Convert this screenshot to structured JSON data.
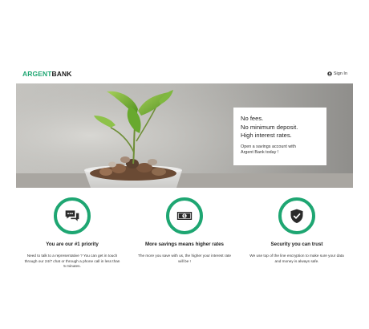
{
  "brand": {
    "accent_text": "ARGENT",
    "rest_text": "BANK",
    "accent_color": "#1ea672"
  },
  "header": {
    "signin_icon": "user-circle-icon",
    "signin_label": "Sign In"
  },
  "hero": {
    "image": "plant-sprout-in-coins-photo",
    "promo_lines": [
      "No fees.",
      "No minimum deposit.",
      "High interest rates."
    ],
    "promo_sub_1": "Open a savings account with",
    "promo_sub_2": "Argent Bank today !"
  },
  "features": [
    {
      "icon": "chat-icon",
      "title": "You are our #1 priority",
      "desc": "Need to talk to a representative ? You can get in touch through our 24/7 chat or through a phone call in less than 5 minutes."
    },
    {
      "icon": "money-icon",
      "title": "More savings means higher rates",
      "desc": "The more you save with us, the higher your interest rate will be !"
    },
    {
      "icon": "shield-check-icon",
      "title": "Security you can trust",
      "desc": "We use top of the line encryption to make sure your data and money is always safe."
    }
  ]
}
